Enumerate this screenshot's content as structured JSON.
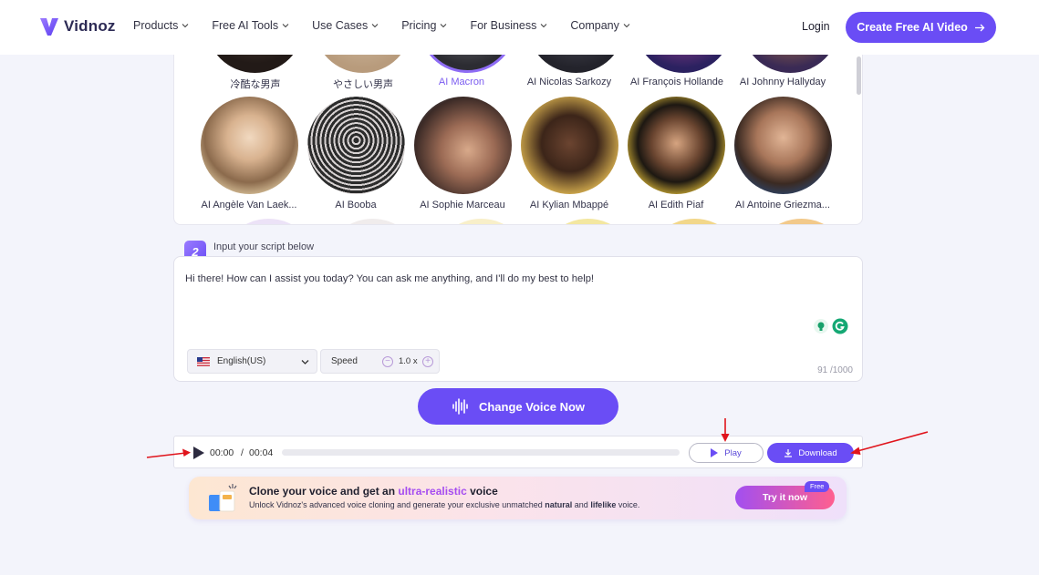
{
  "header": {
    "brand": "Vidnoz",
    "nav": [
      "Products",
      "Free AI Tools",
      "Use Cases",
      "Pricing",
      "For Business",
      "Company"
    ],
    "login": "Login",
    "cta": "Create Free AI Video"
  },
  "avatars_top": [
    "冷酷な男声",
    "やさしい男声",
    "AI Macron",
    "AI Nicolas Sarkozy",
    "AI François Hollande",
    "AI Johnny Hallyday"
  ],
  "avatars_mid": [
    "AI Angèle Van Laek...",
    "AI Booba",
    "AI Sophie Marceau",
    "AI Kylian Mbappé",
    "AI Edith Piaf",
    "AI Antoine Griezma..."
  ],
  "selected_avatar": "AI Macron",
  "step2": {
    "number": "2",
    "label": "Input your script below",
    "script": "Hi there! How can I assist you today? You can ask me anything, and I'll do my best to help!",
    "language": "English(US)",
    "speed_label": "Speed",
    "speed_value": "1.0 x",
    "counter": "91 /1000"
  },
  "change_voice": "Change Voice Now",
  "player": {
    "current": "00:00",
    "separator": "/",
    "duration": "00:04",
    "progress": 0,
    "play": "Play",
    "download": "Download"
  },
  "banner": {
    "title_pre": "Clone your voice and get an ",
    "title_hl": "ultra-realistic",
    "title_post": " voice",
    "sub_pre": "Unlock Vidnoz's advanced voice cloning and generate your exclusive unmatched ",
    "sub_b1": "natural",
    "sub_mid": " and ",
    "sub_b2": "lifelike",
    "sub_post": " voice.",
    "button": "Try it now",
    "badge": "Free"
  },
  "colors": {
    "accent": "#6a4df5",
    "annotation": "#e0141c"
  }
}
